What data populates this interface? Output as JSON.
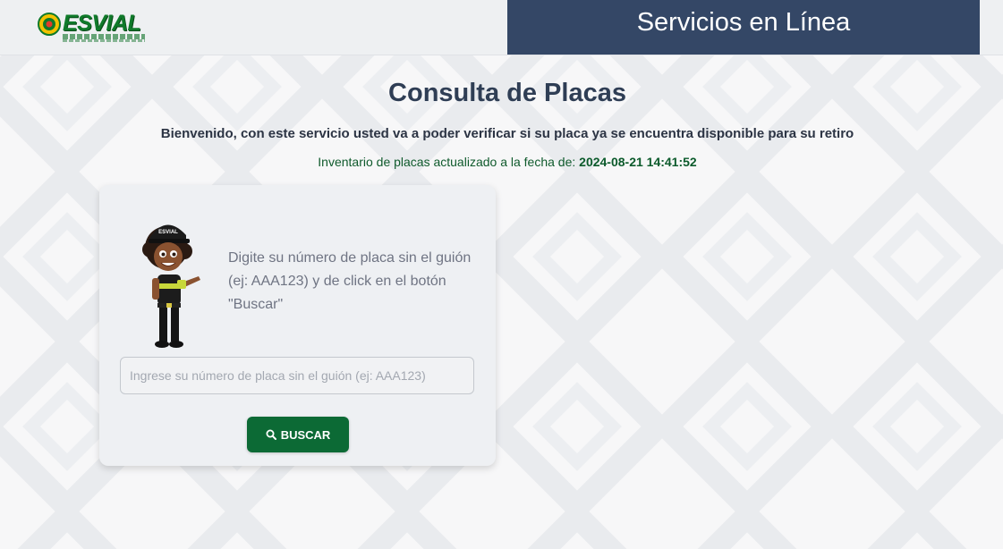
{
  "header": {
    "logo_text": "ESVIAL",
    "logo_subtext": "EMPRESA PÚBLICA DE TRÁNSITO, TRANSPORTE TERRESTRE Y SEGURIDAD VIAL DEL CANTÓN ESMERALDAS",
    "banner_title": "Servicios en Línea"
  },
  "main": {
    "title": "Consulta de Placas",
    "welcome": "Bienvenido, con este servicio usted va a poder verificar si su placa ya se encuentra disponible para su retiro",
    "inventory_label": "Inventario de placas actualizado a la fecha de:",
    "inventory_datetime": "2024-08-21 14:41:52"
  },
  "card": {
    "mascot_cap_text": "ESVIAL",
    "instructions": "Digite su número de placa sin el guión (ej: AAA123) y de click en el botón \"Buscar\"",
    "input_value": "",
    "input_placeholder": "Ingrese su número de placa sin el guión (ej: AAA123)",
    "search_button_label": "BUSCAR",
    "search_icon": "search-icon"
  },
  "colors": {
    "banner_bg": "#344766",
    "primary_green": "#0c6a35",
    "title_color": "#2f3e55",
    "card_bg": "#eef0f3"
  }
}
